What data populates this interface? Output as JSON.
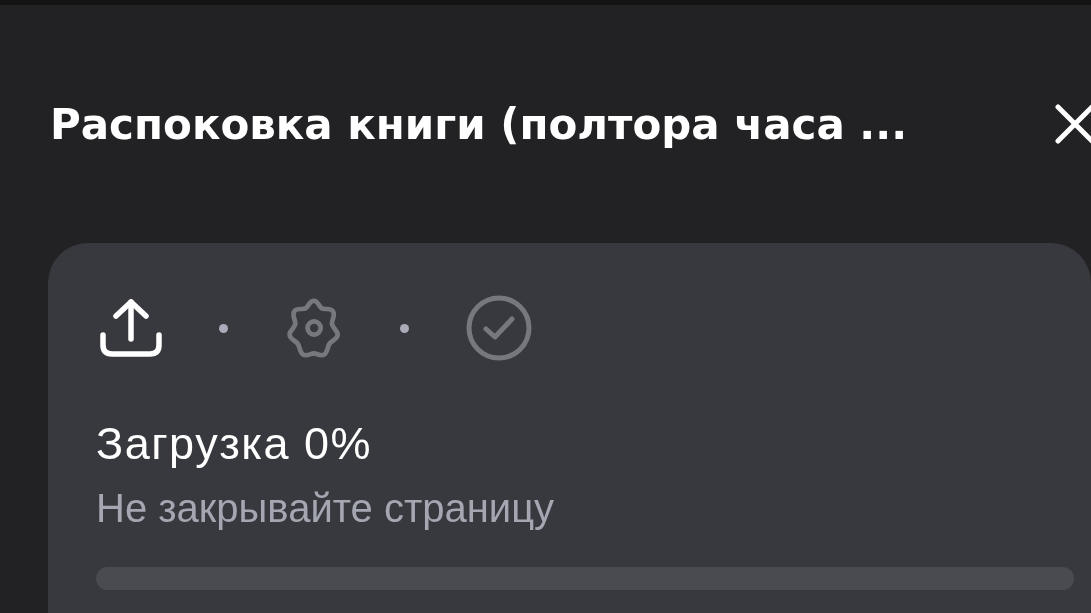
{
  "header": {
    "title": "Распоковка книги (полтора часа ..."
  },
  "upload_card": {
    "steps": [
      {
        "kind": "upload",
        "active": true
      },
      {
        "kind": "processing",
        "active": false
      },
      {
        "kind": "done",
        "active": false
      }
    ],
    "status": "Загрузка 0%",
    "hint": "Не закрывайте страницу",
    "progress": {
      "level": 0
    }
  }
}
